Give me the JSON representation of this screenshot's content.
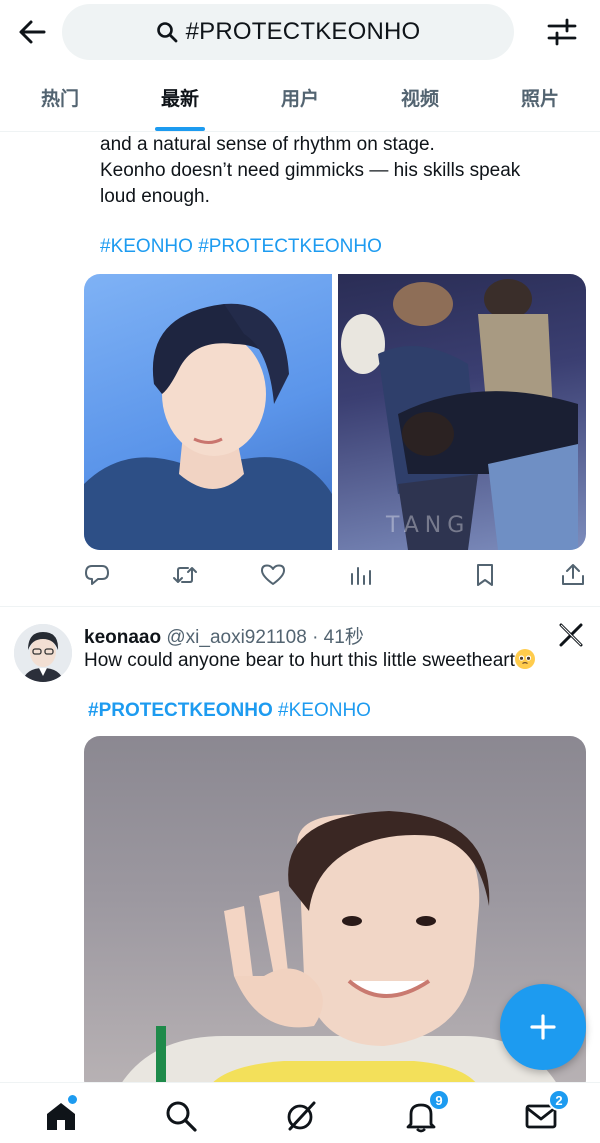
{
  "search": {
    "query": "#PROTECTKEONHO"
  },
  "tabs": [
    {
      "label": "热门",
      "active": false
    },
    {
      "label": "最新",
      "active": true
    },
    {
      "label": "用户",
      "active": false
    },
    {
      "label": "视频",
      "active": false
    },
    {
      "label": "照片",
      "active": false
    }
  ],
  "tweet1": {
    "text_lines": [
      "and a natural sense of rhythm on stage.",
      "Keonho doesn’t need gimmicks — his skills speak",
      "loud enough."
    ],
    "hashtags": "#KEONHO #PROTECTKEONHO",
    "watermark": "TANG"
  },
  "tweet2": {
    "name": "keonaao",
    "handle": "@xi_aoxi921108 · 41秒",
    "text": "How could anyone bear to hurt this little sweetheart",
    "hashtag_bold": "#PROTECTKEONHO",
    "hashtag_normal": " #KEONHO"
  },
  "icons": {
    "back": "arrow-left-icon",
    "filter": "sliders-icon",
    "reply": "reply-icon",
    "retweet": "retweet-icon",
    "like": "heart-icon",
    "views": "views-icon",
    "bookmark": "bookmark-icon",
    "share": "share-icon",
    "home": "home-icon",
    "search": "search-icon",
    "grok": "grok-icon",
    "notifications": "bell-icon",
    "messages": "mail-icon",
    "compose": "plus-icon"
  },
  "badges": {
    "notifications": "9",
    "messages": "2"
  },
  "colors": {
    "accent": "#1d9bf0",
    "text": "#0f1419",
    "muted": "#536471"
  }
}
